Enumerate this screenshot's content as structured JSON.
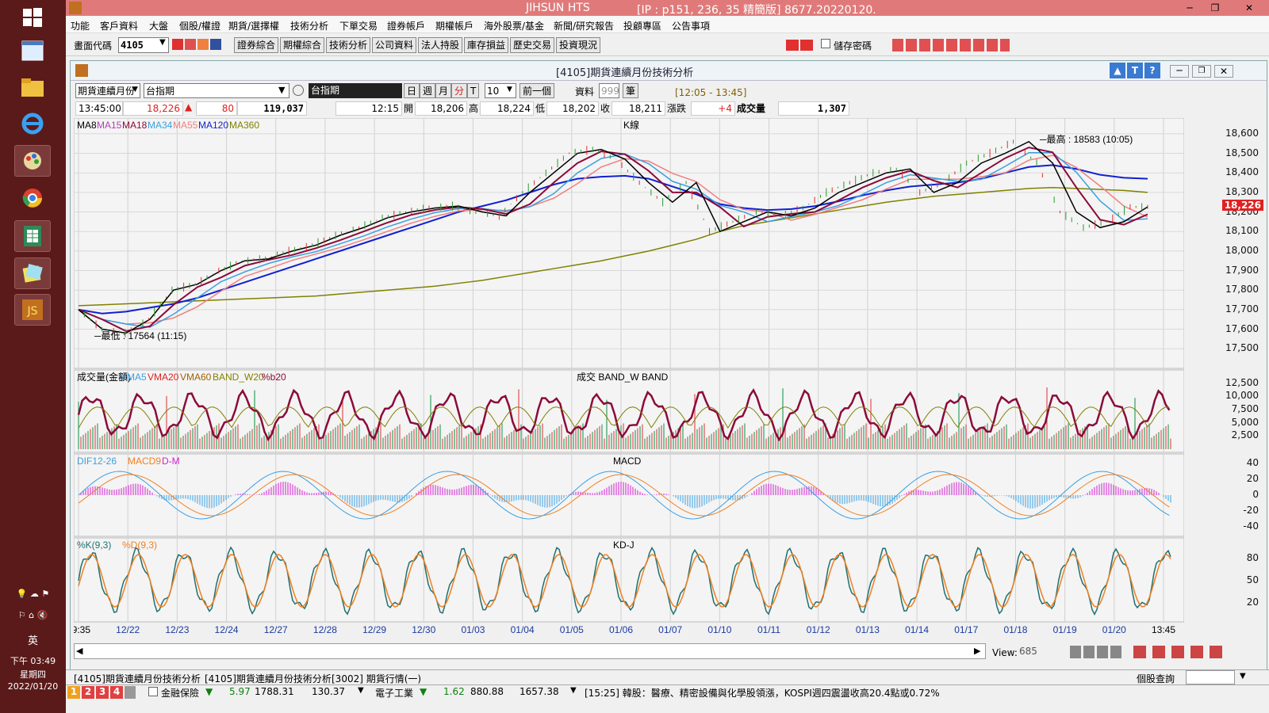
{
  "app": {
    "title": "JIHSUN HTS",
    "title_info": "[IP : p151, 236, 35 精簡版] 8677.20220120."
  },
  "menu": [
    "功能",
    "客戶資料",
    "大盤",
    "個股/權證",
    "期貨/選擇權",
    "技術分析",
    "下單交易",
    "證券帳戶",
    "期權帳戶",
    "海外股票/基金",
    "新聞/研究報告",
    "投顧專區",
    "公告事項"
  ],
  "toolbar": {
    "code_label": "畫面代碼",
    "code_value": "4105",
    "buttons": [
      "證券綜合",
      "期權綜合",
      "技術分析",
      "公司資料",
      "法人持股",
      "庫存損益",
      "歷史交易",
      "投資現況"
    ],
    "save_password_label": "儲存密碼"
  },
  "window": {
    "title": "[4105]期貨連續月份技術分析",
    "product_select": "期貨連續月份",
    "index_select": "台指期",
    "selected_name": "台指期",
    "period_buttons": [
      "日",
      "週",
      "月",
      "分",
      "T"
    ],
    "minute_value": "10",
    "prev_label": "前一個",
    "data_label": "資料",
    "data_count": "999",
    "unit_label": "筆",
    "time_range": "[12:05 - 13:45]"
  },
  "quote": {
    "time": "13:45:00",
    "price": "18,226",
    "change": "80",
    "volume_total": "119,037",
    "bar_time": "12:15",
    "open_label": "開",
    "open": "18,206",
    "high_label": "高",
    "high": "18,224",
    "low_label": "低",
    "low": "18,202",
    "close_label": "收",
    "close": "18,211",
    "chg_label": "漲跌",
    "chg": "+4",
    "vol_label": "成交量",
    "vol": "1,307"
  },
  "chart_data": [
    {
      "type": "line",
      "title": "K線",
      "legend": [
        "MA8",
        "MA15",
        "MA18",
        "MA34",
        "MA55",
        "MA120",
        "MA360"
      ],
      "legend_colors": [
        "#000000",
        "#b040b0",
        "#8b0a3a",
        "#3aa0e0",
        "#f08080",
        "#1020d0",
        "#808000"
      ],
      "y_ticks": [
        18600,
        18500,
        18400,
        18300,
        18200,
        18100,
        18000,
        17900,
        17800,
        17700,
        17600,
        17500
      ],
      "ylim": [
        17440,
        18640
      ],
      "x_ticks": [
        "09:35",
        "12/22",
        "12/23",
        "12/24",
        "12/27",
        "12/28",
        "12/29",
        "12/30",
        "01/03",
        "01/04",
        "01/05",
        "01/06",
        "01/07",
        "01/10",
        "01/11",
        "01/12",
        "01/13",
        "01/14",
        "01/17",
        "01/18",
        "01/19",
        "01/20",
        "13:45"
      ],
      "annotations": [
        "最高 : 18583 (10:05)",
        "最低 : 17564 (11:15)"
      ],
      "last_price": "18,226",
      "close_series": [
        17700,
        17600,
        17580,
        17650,
        17800,
        17830,
        17900,
        17950,
        17960,
        18000,
        18030,
        18080,
        18120,
        18170,
        18200,
        18220,
        18230,
        18200,
        18180,
        18300,
        18400,
        18500,
        18520,
        18470,
        18350,
        18250,
        18350,
        18100,
        18150,
        18200,
        18180,
        18220,
        18300,
        18350,
        18400,
        18420,
        18300,
        18350,
        18450,
        18500,
        18560,
        18450,
        18200,
        18120,
        18150,
        18226
      ],
      "ma120_series": [
        17700,
        17680,
        17690,
        17710,
        17730,
        17760,
        17800,
        17840,
        17880,
        17920,
        17960,
        18000,
        18040,
        18080,
        18120,
        18160,
        18200,
        18230,
        18260,
        18300,
        18340,
        18370,
        18380,
        18385,
        18370,
        18330,
        18290,
        18240,
        18220,
        18210,
        18215,
        18230,
        18255,
        18285,
        18310,
        18330,
        18340,
        18350,
        18370,
        18400,
        18430,
        18440,
        18420,
        18390,
        18375,
        18370
      ],
      "ma360_series": [
        17720,
        17725,
        17730,
        17735,
        17740,
        17745,
        17750,
        17755,
        17760,
        17765,
        17770,
        17780,
        17790,
        17800,
        17810,
        17820,
        17835,
        17850,
        17870,
        17890,
        17910,
        17930,
        17950,
        17975,
        18000,
        18030,
        18060,
        18100,
        18130,
        18150,
        18170,
        18190,
        18210,
        18230,
        18250,
        18265,
        18280,
        18290,
        18300,
        18310,
        18320,
        18325,
        18320,
        18315,
        18310,
        18300
      ]
    },
    {
      "type": "bar",
      "title": "成交 BAND_W BAND",
      "legend": [
        "成交量(金額)",
        "VMA5",
        "VMA20",
        "VMA60",
        "BAND_W20",
        "%b20"
      ],
      "legend_colors": [
        "#000000",
        "#3aa0e0",
        "#e02020",
        "#a06000",
        "#808000",
        "#8b0a3a"
      ],
      "y_ticks": [
        12500,
        10000,
        7500,
        5000,
        2500
      ]
    },
    {
      "type": "line",
      "title": "MACD",
      "legend": [
        "DIF12-26",
        "MACD9",
        "D-M"
      ],
      "legend_colors": [
        "#3aa0e0",
        "#f08020",
        "#d020d0"
      ],
      "y_ticks": [
        40,
        20,
        0,
        -20,
        -40
      ]
    },
    {
      "type": "line",
      "title": "KD-J",
      "legend": [
        "%K(9,3)",
        "%D(9,3)"
      ],
      "legend_colors": [
        "#207070",
        "#f08020"
      ],
      "y_ticks": [
        80,
        50,
        20
      ]
    }
  ],
  "view": {
    "label": "View:",
    "value": "685"
  },
  "tabs": [
    "[4105]期貨連續月份技術分析",
    "[4105]期貨連續月份技術分析",
    "[3002] 期貨行情(一)"
  ],
  "individual_query": "個股查詢",
  "ticker": {
    "pages": [
      "1",
      "2",
      "3",
      "4"
    ],
    "item1_name": "金融保險",
    "item1_chg": "5.97",
    "item1_val": "1788.31",
    "item1_vol": "130.37",
    "item2_name": "電子工業",
    "item2_chg": "1.62",
    "item2_val": "880.88",
    "item2_vol": "1657.38",
    "news": "[15:25] 韓股：醫療、精密設備與化學股領漲，KOSPI週四震盪收高20.4點或0.72%"
  },
  "tray": {
    "ime": "英",
    "time": "下午 03:49",
    "weekday": "星期四",
    "date": "2022/01/20"
  }
}
